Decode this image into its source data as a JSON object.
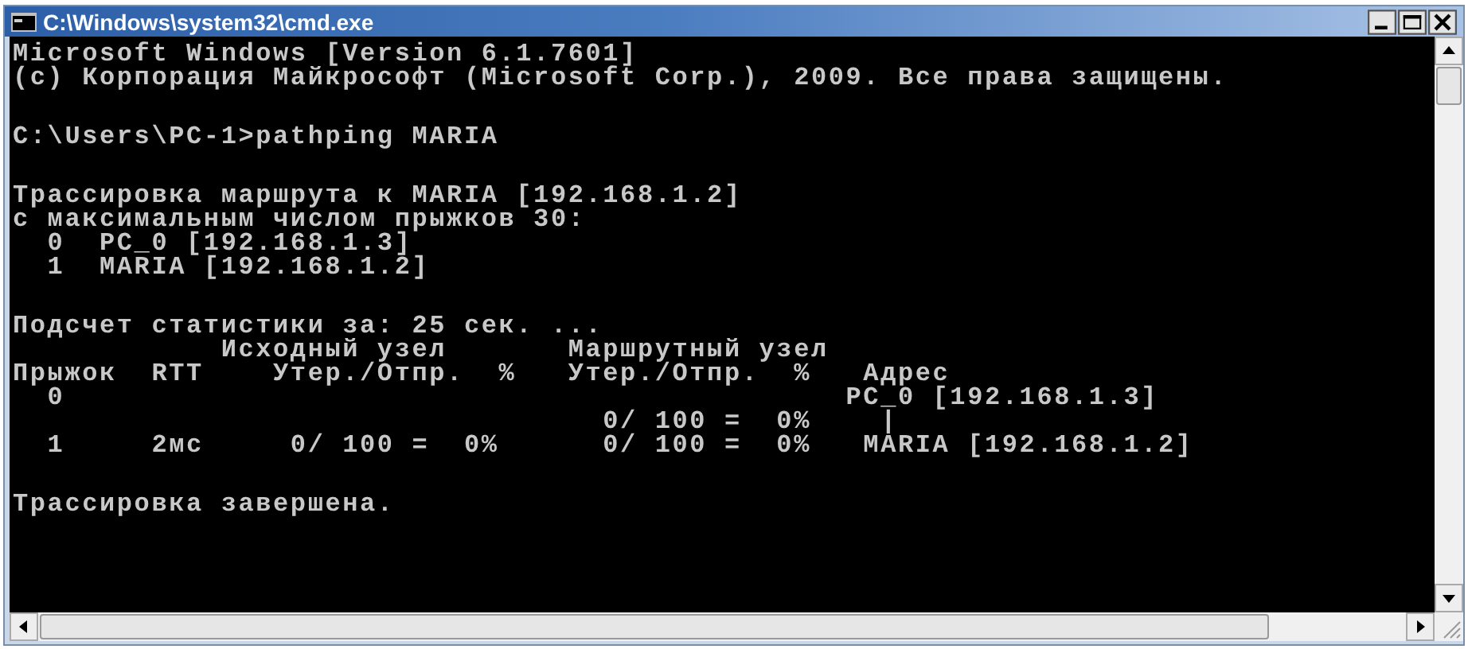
{
  "window": {
    "title": "C:\\Windows\\system32\\cmd.exe"
  },
  "console": {
    "blocks": [
      [
        "Microsoft Windows [Version 6.1.7601]",
        "(c) Корпорация Майкрософт (Microsoft Corp.), 2009. Все права защищены."
      ],
      [
        "C:\\Users\\PC-1>pathping MARIA"
      ],
      [
        "Трассировка маршрута к MARIA [192.168.1.2]",
        "с максимальным числом прыжков 30:",
        "  0  PC_0 [192.168.1.3]",
        "  1  MARIA [192.168.1.2]"
      ],
      [
        "Подсчет статистики за: 25 сек. ...",
        "            Исходный узел       Маршрутный узел",
        "Прыжок  RTT    Утер./Отпр.  %   Утер./Отпр.  %   Адрес",
        "  0                                             PC_0 [192.168.1.3]",
        "                                  0/ 100 =  0%    |",
        "  1     2мс     0/ 100 =  0%      0/ 100 =  0%   MARIA [192.168.1.2]"
      ],
      [
        "Трассировка завершена."
      ]
    ]
  }
}
